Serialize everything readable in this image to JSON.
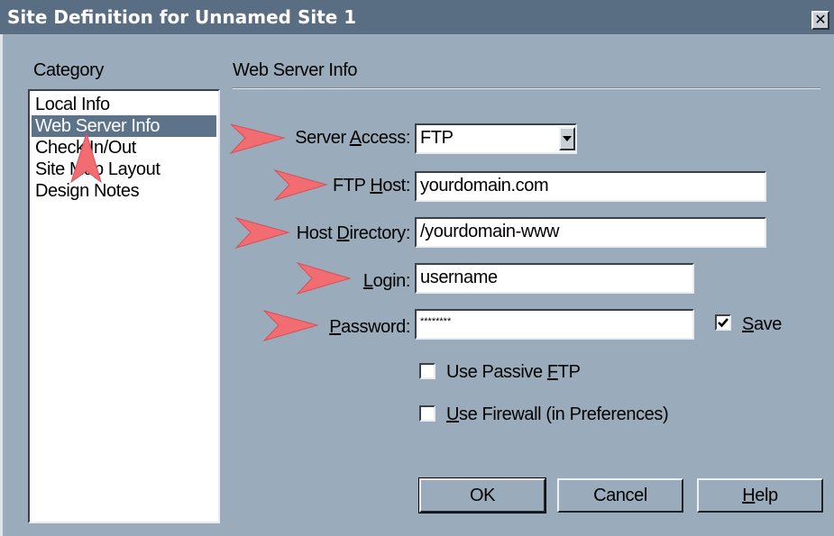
{
  "window": {
    "title": "Site Definition for Unnamed Site 1",
    "close_symbol": "✕"
  },
  "category": {
    "heading": "Category",
    "items": [
      "Local Info",
      "Web Server Info",
      "Check In/Out",
      "Site Map Layout",
      "Design Notes"
    ],
    "selected": "Web Server Info"
  },
  "panel": {
    "heading": "Web Server Info"
  },
  "form": {
    "server_access": {
      "label_pre": "Server ",
      "label_mnemonic": "A",
      "label_post": "ccess:",
      "value": "FTP"
    },
    "ftp_host": {
      "label_pre": "FTP ",
      "label_mnemonic": "H",
      "label_post": "ost:",
      "value": "yourdomain.com"
    },
    "host_directory": {
      "label_pre": "Host ",
      "label_mnemonic": "D",
      "label_post": "irectory:",
      "value": "/yourdomain-www"
    },
    "login": {
      "label_pre": "",
      "label_mnemonic": "L",
      "label_post": "ogin:",
      "value": "username"
    },
    "password": {
      "label_pre": "",
      "label_mnemonic": "P",
      "label_post": "assword:",
      "value": "********"
    },
    "save": {
      "label_pre": "",
      "label_mnemonic": "S",
      "label_post": "ave",
      "checked": true
    },
    "passive_ftp": {
      "label_pre": "Use Passive ",
      "label_mnemonic": "F",
      "label_post": "TP",
      "checked": false
    },
    "firewall": {
      "label_pre": "",
      "label_mnemonic": "U",
      "label_post": "se Firewall (in Preferences)",
      "checked": false
    }
  },
  "buttons": {
    "ok": "OK",
    "cancel": "Cancel",
    "help_mnemonic": "H",
    "help_post": "elp"
  },
  "colors": {
    "dialog_bg": "#9aacbb",
    "titlebar": "#5a6e83",
    "selection": "#5d738a",
    "callout_arrow": "#f26d72"
  }
}
